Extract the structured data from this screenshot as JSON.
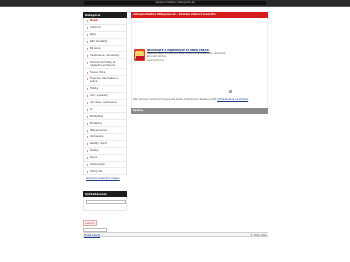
{
  "site": {
    "title": "oskarproduktov ďakujeme.sk"
  },
  "sidebar": {
    "heading": "Kategórie",
    "categories": [
      "Úvod",
      "Aukčníci",
      "Byty",
      "B2C kontakty",
      "Bývanie",
      "Cestovanie, dovolenky",
      "Domáci kontakty je najlepšia evidencia",
      "Fauna, flóra",
      "Financie, kancelárie a práce",
      "Hobby",
      "Info, výsledky",
      "Inf. ulica, cestovanie",
      "IT",
      "Marketing",
      "Modeling",
      "Nakupovanie",
      "Občianske",
      "Reality, šport",
      "Služby",
      "Šport",
      "Ubytovanie",
      "Voľný čas"
    ],
    "bottom_link": "Ochrana osobných údajov",
    "search_heading": "Vyhľadávanie",
    "search_placeholder": "",
    "search_label": "",
    "captcha_text": "qwerty",
    "captcha_button": "OK"
  },
  "main": {
    "heading": "oskarproduktov ďakujeme.sk – Zoznam zmien k inzerátu",
    "ad": {
      "title": "NEVÁHAJTE A OBJEDNAJTE SI HNEĎ TERAZ!",
      "text": "Najkvalitnejšie výrobky pre vašu rodinu za výhodné ceny, doručenie až k vám domov.",
      "url": "www.obchod.sk"
    },
    "notice_text": "Táto stránka mohla byť presunutá alebo odstránená. Skúste použiť",
    "notice_link": "Vyhľadávanie na stránke",
    "section_title": "Správy"
  },
  "footer": {
    "left": "Pridať inzerát",
    "right": "© 2020 oskar"
  },
  "colors": {
    "accent": "#d51b1b",
    "dark": "#1e1e1e",
    "link": "#1a3f8f"
  }
}
